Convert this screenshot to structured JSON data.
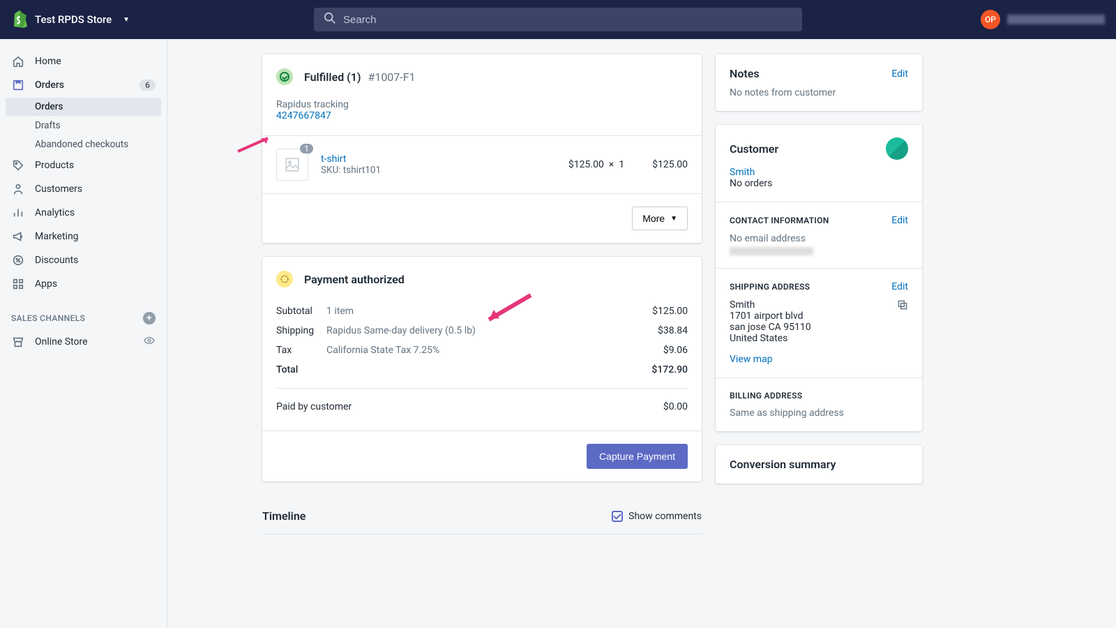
{
  "topbar": {
    "store_name": "Test RPDS Store",
    "search_placeholder": "Search",
    "avatar_initials": "OP"
  },
  "sidebar": {
    "main": [
      {
        "label": "Home"
      },
      {
        "label": "Orders",
        "badge": "6",
        "active": true
      },
      {
        "label": "Products"
      },
      {
        "label": "Customers"
      },
      {
        "label": "Analytics"
      },
      {
        "label": "Marketing"
      },
      {
        "label": "Discounts"
      },
      {
        "label": "Apps"
      }
    ],
    "orders_sub": [
      {
        "label": "Orders",
        "active": true
      },
      {
        "label": "Drafts"
      },
      {
        "label": "Abandoned checkouts"
      }
    ],
    "channels_label": "SALES CHANNELS",
    "channels": [
      {
        "label": "Online Store"
      }
    ]
  },
  "fulfillment": {
    "title": "Fulfilled (1)",
    "ref": "#1007-F1",
    "tracking_label": "Rapidus tracking",
    "tracking_number": "4247667847",
    "item": {
      "qty_badge": "1",
      "name": "t-shirt",
      "sku_label": "SKU: tshirt101",
      "price": "$125.00",
      "qty_sep": "×",
      "qty": "1",
      "line_total": "$125.00"
    },
    "more_label": "More"
  },
  "payment": {
    "title": "Payment authorized",
    "rows": {
      "subtotal_label": "Subtotal",
      "subtotal_desc": "1 item",
      "subtotal_amount": "$125.00",
      "shipping_label": "Shipping",
      "shipping_desc": "Rapidus Same-day delivery (0.5 lb)",
      "shipping_amount": "$38.84",
      "tax_label": "Tax",
      "tax_desc": "California State Tax 7.25%",
      "tax_amount": "$9.06",
      "total_label": "Total",
      "total_amount": "$172.90",
      "paid_label": "Paid by customer",
      "paid_amount": "$0.00"
    },
    "capture_label": "Capture Payment"
  },
  "timeline": {
    "title": "Timeline",
    "show_comments": "Show comments"
  },
  "notes": {
    "title": "Notes",
    "edit": "Edit",
    "empty": "No notes from customer"
  },
  "customer": {
    "title": "Customer",
    "name": "Smith",
    "orders": "No orders",
    "contact_title": "CONTACT INFORMATION",
    "contact_edit": "Edit",
    "no_email": "No email address",
    "ship_title": "SHIPPING ADDRESS",
    "ship_edit": "Edit",
    "addr_name": "Smith",
    "addr_line1": "1701 airport blvd",
    "addr_line2": "san jose CA 95110",
    "addr_country": "United States",
    "view_map": "View map",
    "bill_title": "BILLING ADDRESS",
    "bill_text": "Same as shipping address"
  },
  "conversion": {
    "title": "Conversion summary"
  }
}
